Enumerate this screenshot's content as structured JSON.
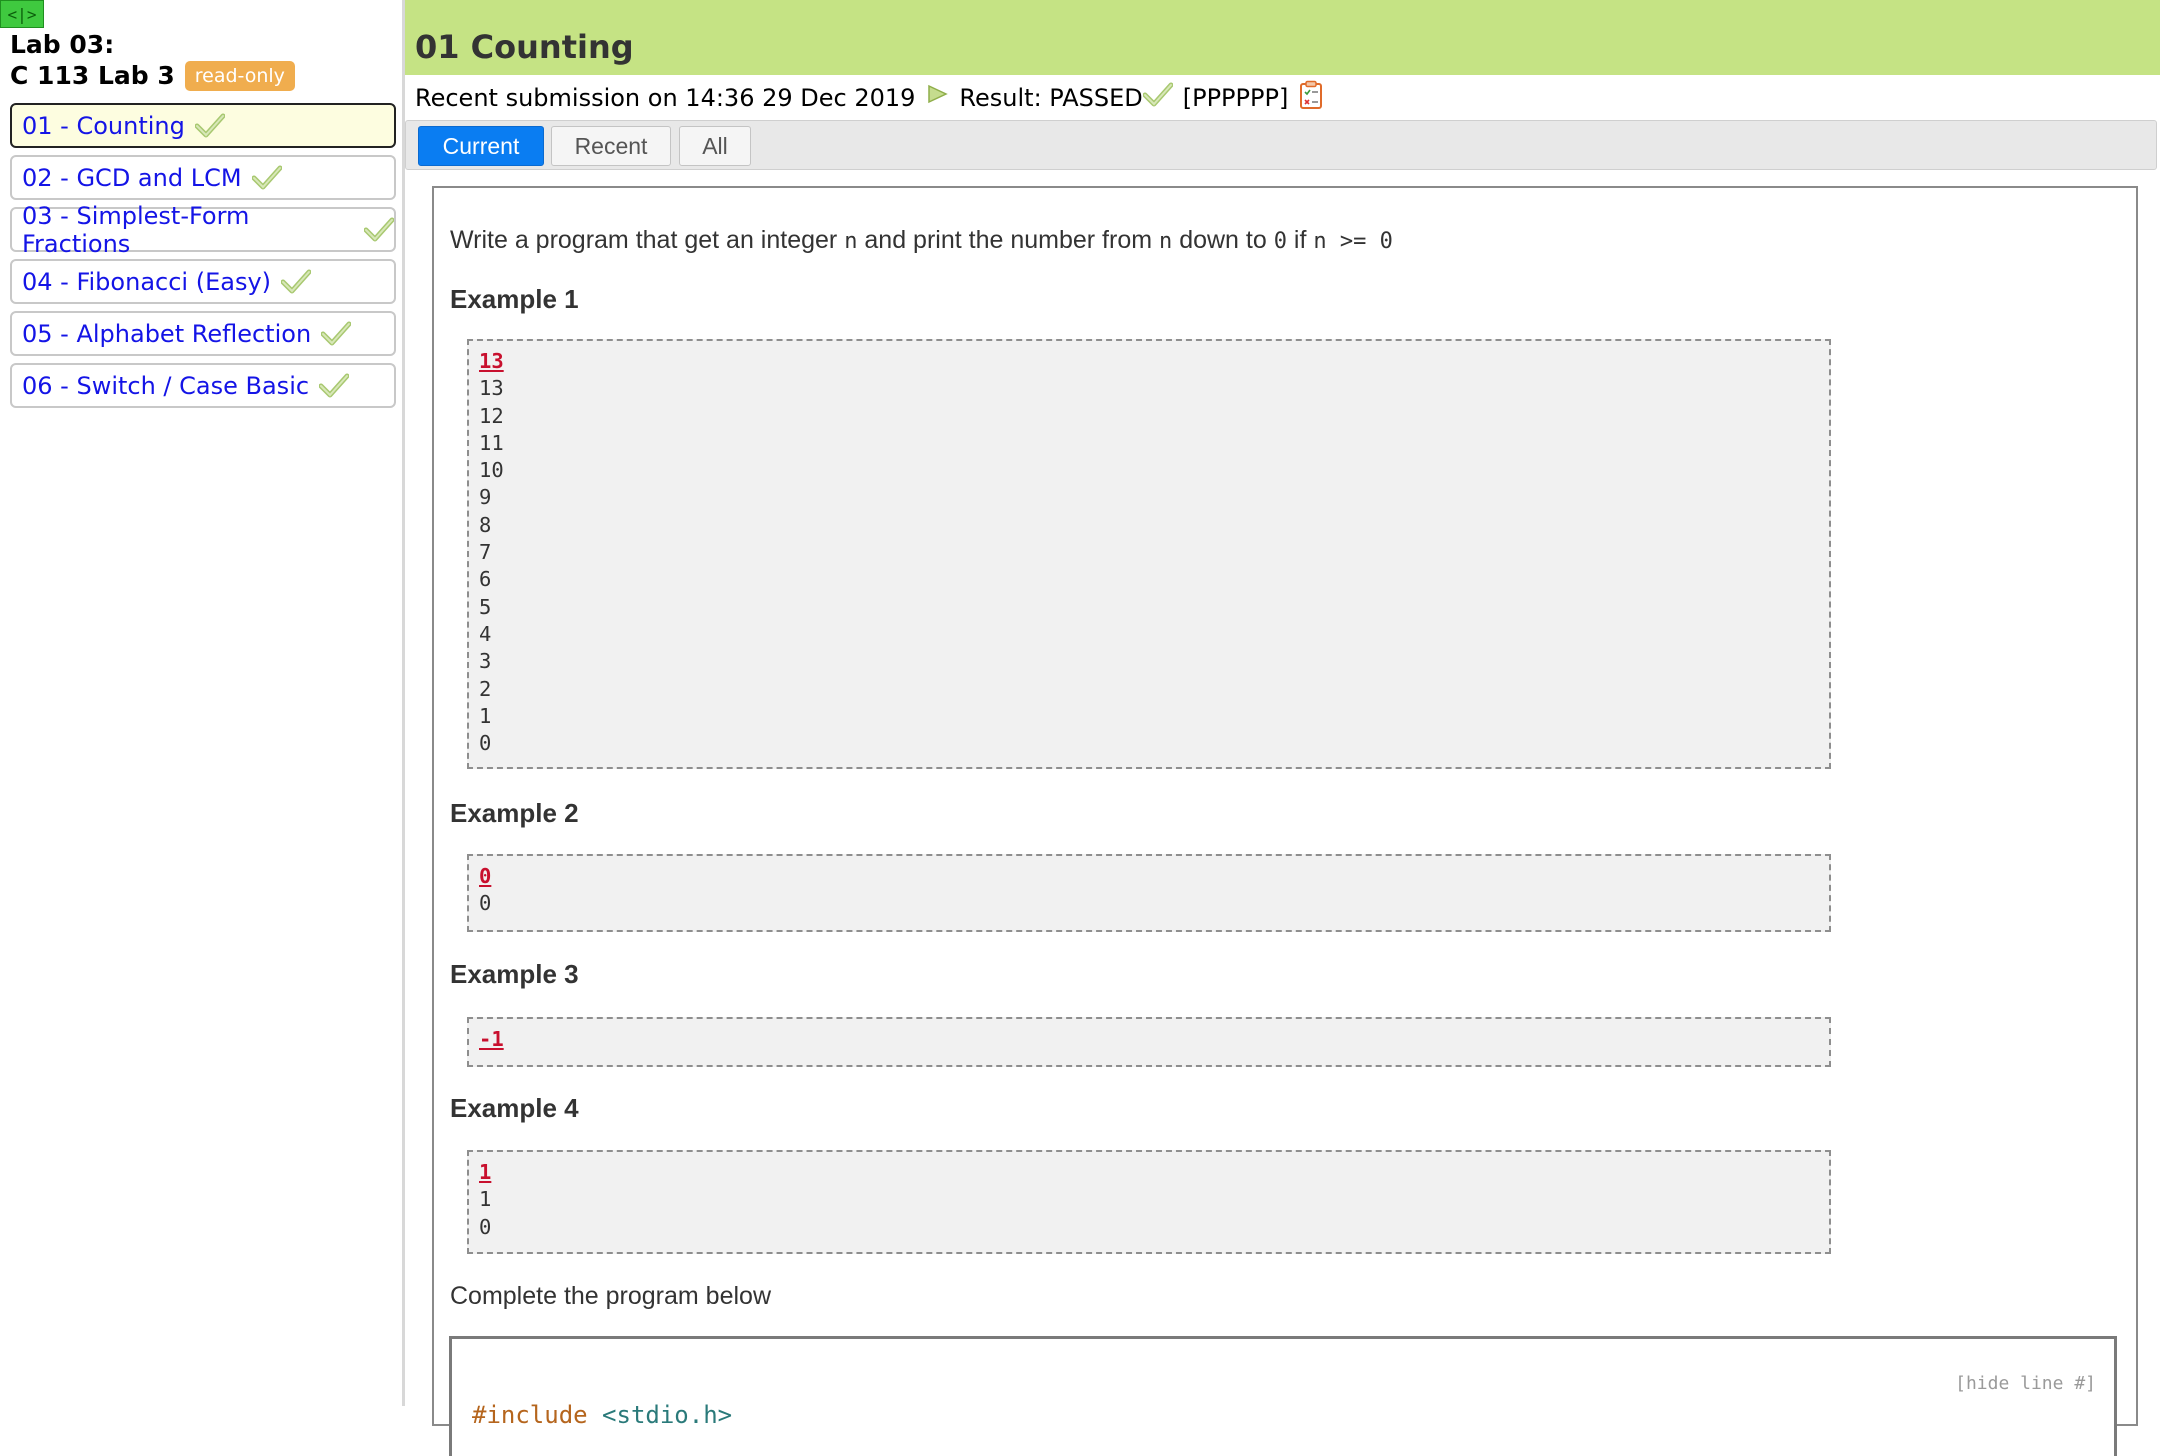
{
  "sidebar": {
    "toggle_label": "<|>",
    "lab_title": "Lab 03:",
    "lab_subtitle": "C 113 Lab 3",
    "badge": "read-only",
    "tasks": [
      {
        "label": "01 - Counting",
        "status": "passed",
        "active": true
      },
      {
        "label": "02 - GCD and LCM",
        "status": "passed"
      },
      {
        "label": "03 - Simplest-Form Fractions",
        "status": "passed"
      },
      {
        "label": "04 - Fibonacci (Easy)",
        "status": "passed"
      },
      {
        "label": "05 - Alphabet Reflection",
        "status": "passed"
      },
      {
        "label": "06 - Switch / Case Basic",
        "status": "passed"
      }
    ]
  },
  "header": {
    "title": "01 Counting",
    "submission_text": "Recent submission on 14:36 29 Dec 2019",
    "result_text": "Result: PASSED",
    "result_code": "[PPPPPP]",
    "icons": [
      "play-icon",
      "check-icon",
      "clipboard-icon"
    ]
  },
  "tabs": [
    {
      "label": "Current",
      "active": true
    },
    {
      "label": "Recent"
    },
    {
      "label": "All"
    }
  ],
  "problem": {
    "statement_parts": {
      "p1": "Write a program that get an integer ",
      "var1": "n",
      "p2": " and print the number from ",
      "var2": "n",
      "p3": " down to ",
      "zero": "0",
      "p4": " if ",
      "cond": "n >= 0"
    },
    "examples": [
      {
        "title": "Example 1",
        "input": "13",
        "output": [
          "13",
          "12",
          "11",
          "10",
          "9",
          "8",
          "7",
          "6",
          "5",
          "4",
          "3",
          "2",
          "1",
          "0"
        ]
      },
      {
        "title": "Example 2",
        "input": "0",
        "output": [
          "0"
        ]
      },
      {
        "title": "Example 3",
        "input": "-1",
        "output": []
      },
      {
        "title": "Example 4",
        "input": "1",
        "output": [
          "1",
          "0"
        ]
      }
    ],
    "complete_label": "Complete the program below",
    "hide_line_label": "[hide line #]",
    "code_first_line": {
      "directive": "#include ",
      "header": "<stdio.h>"
    }
  },
  "colors": {
    "header_bg": "#c5e384",
    "active_tab": "#0a7df2",
    "badge": "#f0ad4e",
    "link": "#1414e6",
    "check": "#a8c870",
    "input_red": "#c8102e"
  }
}
